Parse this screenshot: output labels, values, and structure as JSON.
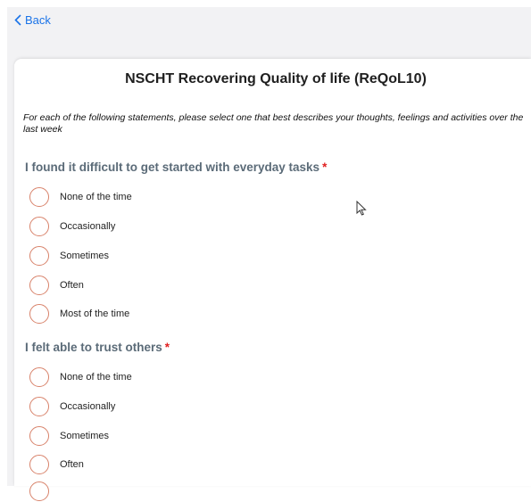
{
  "nav": {
    "back_label": "Back"
  },
  "form": {
    "title": "NSCHT Recovering Quality of life (ReQoL10)",
    "intro": "For each of the following statements, please select one that best describes your thoughts, feelings and activities over the last week",
    "questions": [
      {
        "text": "I found it difficult to get started with everyday tasks",
        "required_mark": "*",
        "options": [
          "None of the time",
          "Occasionally",
          "Sometimes",
          "Often",
          "Most of the time"
        ]
      },
      {
        "text": "I felt able to trust others",
        "required_mark": "*",
        "options": [
          "None of the time",
          "Occasionally",
          "Sometimes",
          "Often"
        ]
      }
    ]
  },
  "colors": {
    "accent": "#1a73e8",
    "question_text": "#5b6b78",
    "required": "#e02020",
    "radio_border": "#d8826a"
  }
}
